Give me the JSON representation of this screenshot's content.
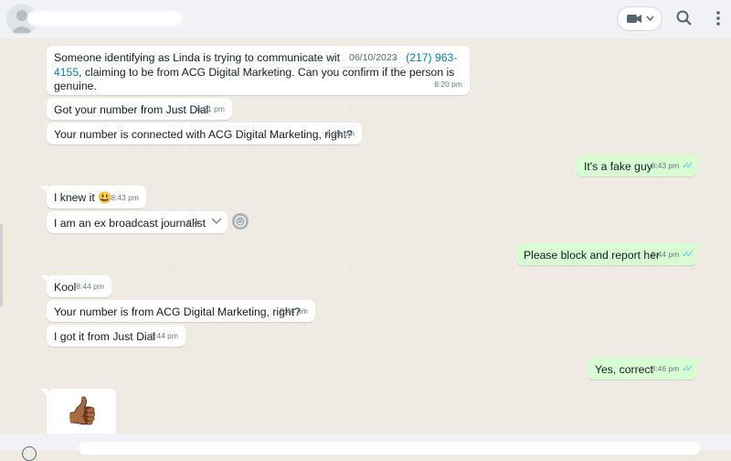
{
  "header": {
    "contact_name": "",
    "icons": [
      "avatar",
      "video-call-icon",
      "chevron-down-icon",
      "search-icon",
      "menu-dots-icon"
    ]
  },
  "date_badge": "06/10/2023",
  "messages": [
    {
      "dir": "in",
      "text_a": "Someone identifying as Linda is trying to communicate with me f",
      "text_b": "ber ",
      "link": "+1 (217) 963-4155",
      "text_c": ", claiming to be from ACG Digital Marketing. Can you confirm if the person is genuine.",
      "time": "8:20 pm"
    },
    {
      "dir": "in",
      "text": "Got your number from Just Dial",
      "time": "8:21 pm"
    },
    {
      "dir": "in",
      "text": "Your number is connected with ACG Digital Marketing, right?",
      "time": "8:21 pm"
    },
    {
      "dir": "out",
      "text": "It's a fake guy",
      "time": "8:43 pm"
    },
    {
      "dir": "in",
      "text": "I knew it",
      "emoji": "😃",
      "time": "8:43 pm"
    },
    {
      "dir": "in",
      "text": "I am an ex broadcast journalist",
      "time": "8:4"
    },
    {
      "dir": "out",
      "text": "Please block and report her",
      "time": "8:44 pm"
    },
    {
      "dir": "in",
      "text": "Kool",
      "time": "8:44 pm"
    },
    {
      "dir": "in",
      "text": "Your number is from ACG Digital Marketing, right?",
      "time": "8:44 pm"
    },
    {
      "dir": "in",
      "text": "I got it from Just Dial",
      "time": "8:44 pm"
    },
    {
      "dir": "out",
      "text": "Yes, correct",
      "time": "8:46 pm"
    },
    {
      "dir": "in",
      "sticker": "👍🏾"
    }
  ],
  "colors": {
    "incoming": "#ffffff",
    "outgoing": "#d9fdd3",
    "background": "#efeae2",
    "link": "#027eb5",
    "read_ticks": "#53bdeb"
  }
}
